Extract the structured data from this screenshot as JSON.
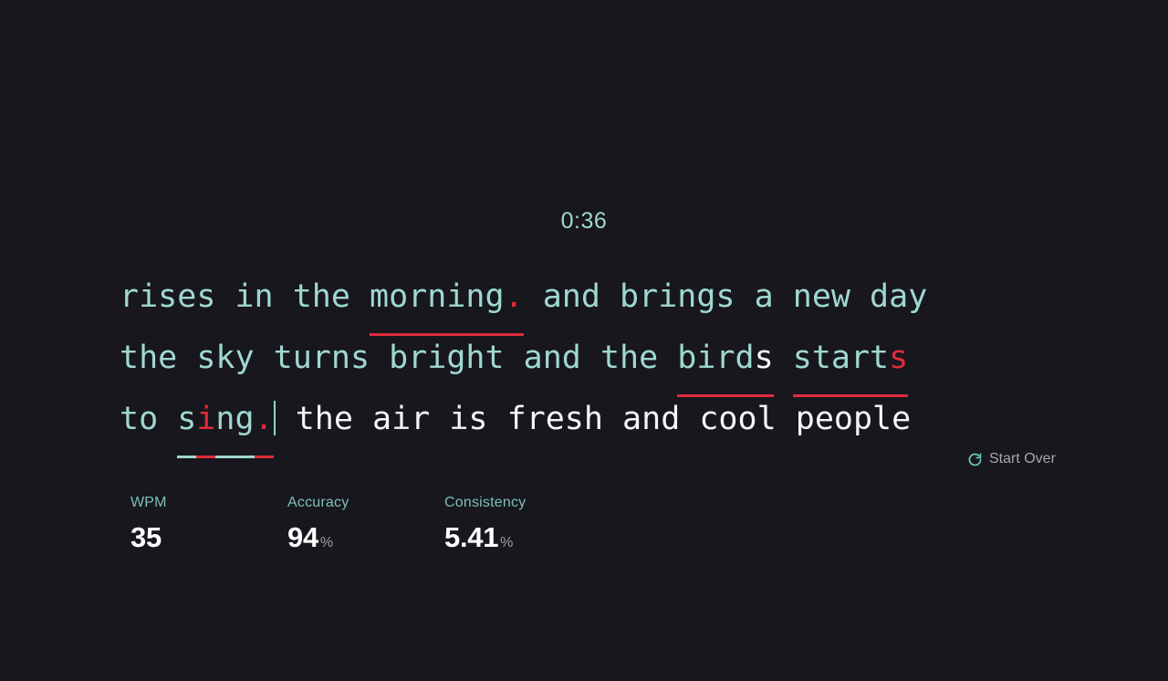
{
  "timer": {
    "value": "0:36"
  },
  "typing": {
    "lines": [
      {
        "segments": [
          {
            "text": "rises in the ",
            "state": "correct",
            "underline": "none"
          },
          {
            "text": "morning",
            "state": "correct",
            "underline": "red"
          },
          {
            "text": ".",
            "state": "incorrect",
            "underline": "red"
          },
          {
            "text": " and brings a new day",
            "state": "correct",
            "underline": "none"
          }
        ]
      },
      {
        "segments": [
          {
            "text": "the sky turns bright and the ",
            "state": "correct",
            "underline": "none"
          },
          {
            "text": "bird",
            "state": "correct",
            "underline": "red"
          },
          {
            "text": "s",
            "state": "extra",
            "underline": "red"
          },
          {
            "text": " ",
            "state": "correct",
            "underline": "none"
          },
          {
            "text": "start",
            "state": "correct",
            "underline": "red"
          },
          {
            "text": "s",
            "state": "incorrect",
            "underline": "red"
          }
        ]
      },
      {
        "segments": [
          {
            "text": "to ",
            "state": "correct",
            "underline": "none"
          },
          {
            "text": "s",
            "state": "correct",
            "underline": "teal"
          },
          {
            "text": "i",
            "state": "incorrect",
            "underline": "red"
          },
          {
            "text": "ng",
            "state": "correct",
            "underline": "teal"
          },
          {
            "text": ".",
            "state": "incorrect",
            "underline": "red"
          },
          {
            "text": "CARET",
            "state": "caret",
            "underline": "none"
          },
          {
            "text": " the air is fresh and cool people",
            "state": "pending",
            "underline": "none"
          }
        ]
      }
    ]
  },
  "start_over": {
    "icon": "refresh-icon",
    "label": "Start Over"
  },
  "stats": [
    {
      "label": "WPM",
      "value": "35",
      "unit": ""
    },
    {
      "label": "Accuracy",
      "value": "94",
      "unit": "%"
    },
    {
      "label": "Consistency",
      "value": "5.41",
      "unit": "%"
    }
  ],
  "colors": {
    "background": "#17171d",
    "correct": "#9fd8d0",
    "pending": "#f5f5f7",
    "error": "#e02b3a",
    "accent": "#6fc9bd",
    "muted": "#a6a8ad"
  }
}
